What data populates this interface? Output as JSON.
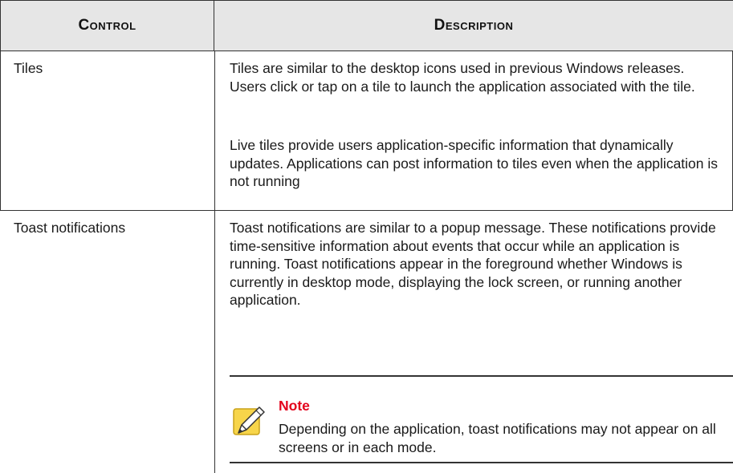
{
  "table": {
    "headers": {
      "control": "Control",
      "description": "Description"
    },
    "rows": [
      {
        "control": "Tiles",
        "paragraphs": [
          "Tiles are similar to the desktop icons used in previous Windows releases. Users click or tap on a tile to launch the application associated with the tile.",
          "Live tiles provide users application-specific information that dynamically updates. Applications can post information to tiles even when the application is not running"
        ]
      },
      {
        "control": "Toast notifications",
        "paragraphs": [
          "Toast notifications are similar to a popup message. These notifications provide time-sensitive information about events that occur while an application is running. Toast notifications appear in the foreground whether Windows is currently in desktop mode, displaying the lock screen, or running another application."
        ],
        "note": {
          "icon": "note-pencil-icon",
          "title": "Note",
          "text": "Depending on the application, toast notifications may not appear on all screens or in each mode."
        }
      }
    ]
  },
  "colors": {
    "header_bg": "#e6e6e6",
    "rule": "#333333",
    "note_title": "#e3001b",
    "note_icon_bg": "#f7d54a"
  }
}
